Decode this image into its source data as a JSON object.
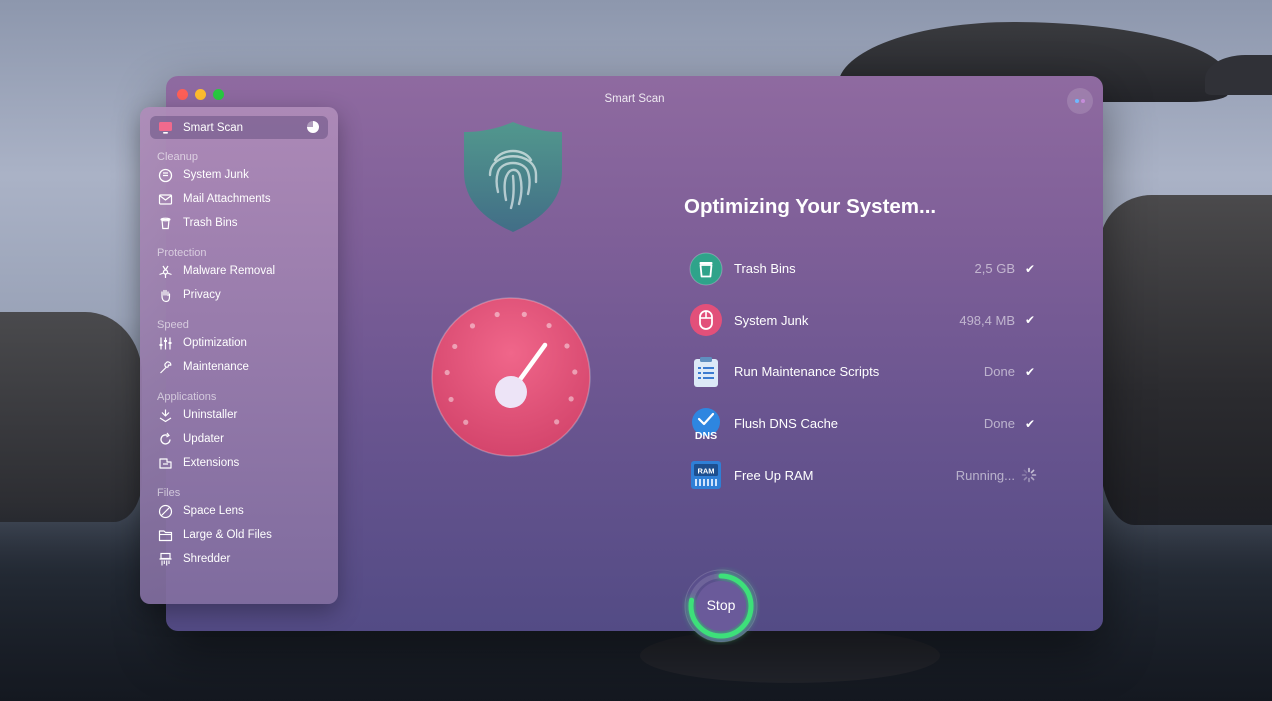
{
  "window": {
    "title": "Smart Scan"
  },
  "sidebar": {
    "active": {
      "label": "Smart Scan",
      "icon": "monitor-icon"
    },
    "sections": [
      {
        "heading": "Cleanup",
        "items": [
          {
            "label": "System Junk",
            "icon": "disk-icon"
          },
          {
            "label": "Mail Attachments",
            "icon": "envelope-icon"
          },
          {
            "label": "Trash Bins",
            "icon": "trash-icon"
          }
        ]
      },
      {
        "heading": "Protection",
        "items": [
          {
            "label": "Malware Removal",
            "icon": "biohazard-icon"
          },
          {
            "label": "Privacy",
            "icon": "hand-icon"
          }
        ]
      },
      {
        "heading": "Speed",
        "items": [
          {
            "label": "Optimization",
            "icon": "sliders-icon"
          },
          {
            "label": "Maintenance",
            "icon": "wrench-icon"
          }
        ]
      },
      {
        "heading": "Applications",
        "items": [
          {
            "label": "Uninstaller",
            "icon": "uninstall-icon"
          },
          {
            "label": "Updater",
            "icon": "update-icon"
          },
          {
            "label": "Extensions",
            "icon": "extensions-icon"
          }
        ]
      },
      {
        "heading": "Files",
        "items": [
          {
            "label": "Space Lens",
            "icon": "lens-icon"
          },
          {
            "label": "Large & Old Files",
            "icon": "folder-icon"
          },
          {
            "label": "Shredder",
            "icon": "shredder-icon"
          }
        ]
      }
    ]
  },
  "main": {
    "headline": "Optimizing Your System...",
    "tasks": [
      {
        "label": "Trash Bins",
        "status": "2,5 GB",
        "state": "done",
        "icon": "trash-bin-icon"
      },
      {
        "label": "System Junk",
        "status": "498,4 MB",
        "state": "done",
        "icon": "system-junk-icon"
      },
      {
        "label": "Run Maintenance Scripts",
        "status": "Done",
        "state": "done",
        "icon": "clipboard-icon"
      },
      {
        "label": "Flush DNS Cache",
        "status": "Done",
        "state": "done",
        "icon": "dns-icon",
        "badge": "DNS"
      },
      {
        "label": "Free Up RAM",
        "status": "Running...",
        "state": "running",
        "icon": "ram-icon",
        "badge": "RAM"
      }
    ],
    "stop_button": {
      "label": "Stop",
      "progress": 0.78
    }
  },
  "colors": {
    "accent_green": "#3ee07a",
    "gauge_pink": "#e8557a",
    "shield_teal": "#3f8c86"
  }
}
